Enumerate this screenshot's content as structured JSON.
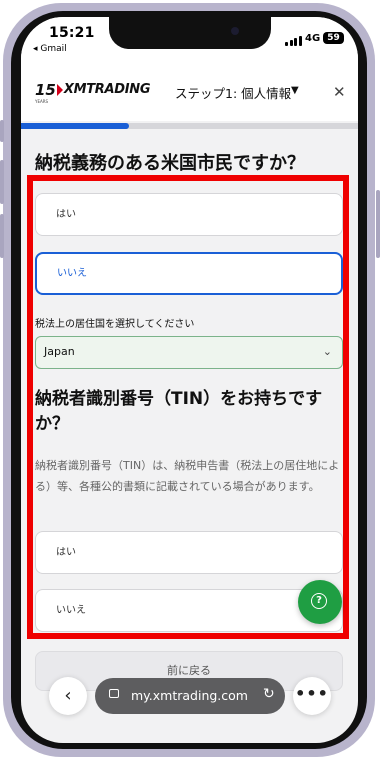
{
  "status": {
    "time": "15:21",
    "back_app": "◂ Gmail",
    "network": "4G",
    "battery": "59"
  },
  "header": {
    "logo_number": "15",
    "logo_brand": "XMTRADING",
    "logo_years": "YEARS",
    "step_label": "ステップ1: 個人情報",
    "chevron_icon": "chevron-down-icon",
    "close_icon": "close-icon"
  },
  "progress": {
    "fraction": 0.32
  },
  "form": {
    "question1": "納税義務のある米国市民ですか？",
    "q1_options": [
      "はい",
      "いいえ"
    ],
    "q1_selected": "いいえ",
    "residence_label": "税法上の居住国を選択してください",
    "residence_value": "Japan",
    "question2": "納税者識別番号（TIN）をお持ちですか？",
    "q2_description": "納税者識別番号（TIN）は、納税申告書（税法上の居住地による）等、各種公的書類に記載されている場合があります。",
    "q2_options": [
      "はい",
      "いいえ"
    ],
    "back_button": "前に戻る"
  },
  "help_icon": "question-mark-icon",
  "browser": {
    "url": "my.xmtrading.com",
    "back_icon": "chevron-left-icon",
    "reload_icon": "reload-icon",
    "more_icon": "ellipsis-icon"
  },
  "colors": {
    "accent": "#1a5fd6",
    "highlight_border": "#ef0000",
    "help_button": "#1f9e43",
    "phone_frame": "#b8b4cc"
  }
}
